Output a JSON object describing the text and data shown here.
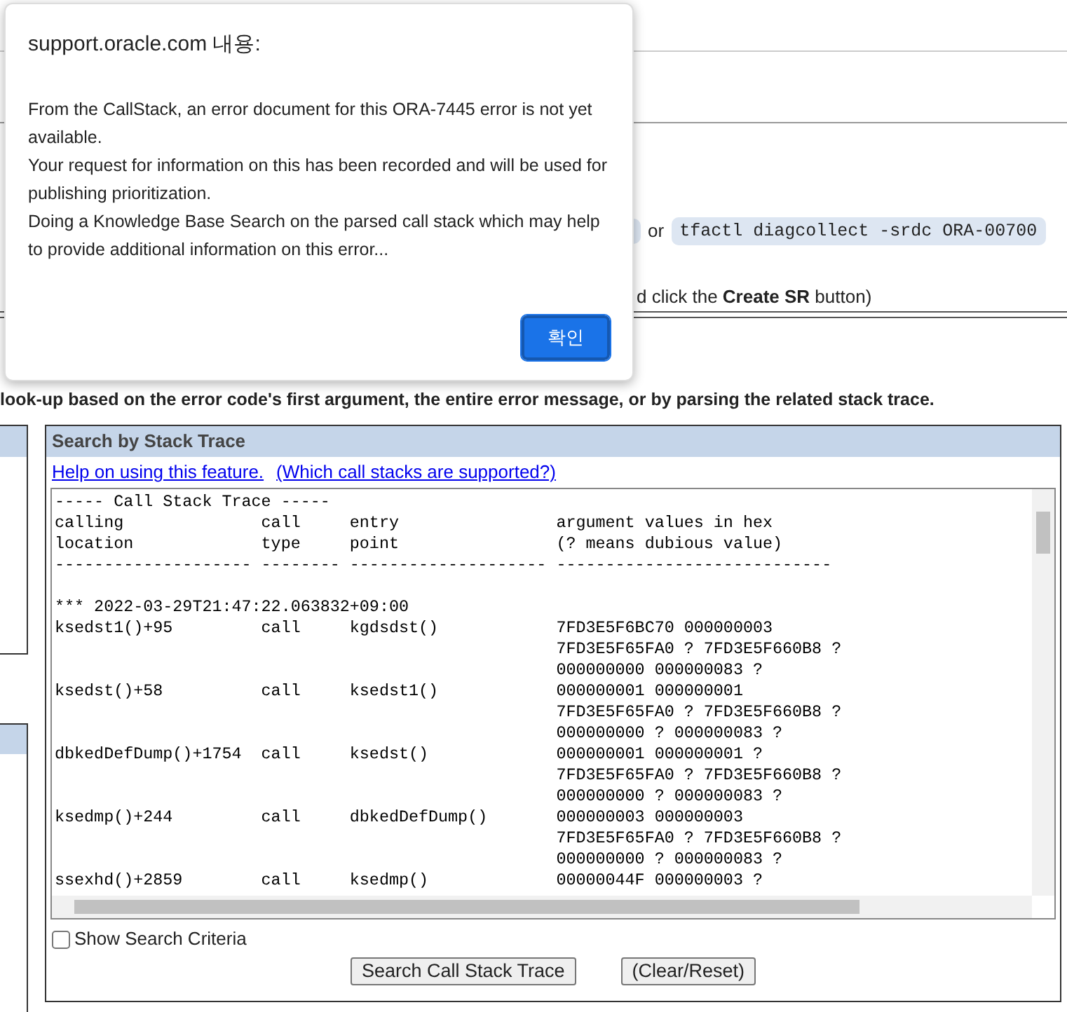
{
  "page": {
    "command_separator": "or",
    "command": "tfactl diagcollect -srdc ORA-00700",
    "instruction": "d click the **Create SR** button)",
    "intro": "look-up based on the error code's first argument, the entire error message, or by parsing the related stack trace."
  },
  "stack_trace_panel": {
    "title": "Search by Stack Trace",
    "links": [
      "Help on using this feature.",
      "(Which call stacks are supported?)"
    ],
    "trace_text": "----- Call Stack Trace -----\ncalling              call     entry                argument values in hex\nlocation             type     point                (? means dubious value)\n-------------------- -------- -------------------- ----------------------------\n\n*** 2022-03-29T21:47:22.063832+09:00\nksedst1()+95         call     kgdsdst()            7FD3E5F6BC70 000000003\n                                                   7FD3E5F65FA0 ? 7FD3E5F660B8 ?\n                                                   000000000 000000083 ?\nksedst()+58          call     ksedst1()            000000001 000000001\n                                                   7FD3E5F65FA0 ? 7FD3E5F660B8 ?\n                                                   000000000 ? 000000083 ?\ndbkedDefDump()+1754  call     ksedst()             000000001 000000001 ?\n                                                   7FD3E5F65FA0 ? 7FD3E5F660B8 ?\n                                                   000000000 ? 000000083 ?\nksedmp()+244         call     dbkedDefDump()       000000003 000000003\n                                                   7FD3E5F65FA0 ? 7FD3E5F660B8 ?\n                                                   000000000 ? 000000083 ?\nssexhd()+2859        call     ksedmp()             00000044F 000000003 ?",
    "show_criteria": {
      "label": "Show Search Criteria",
      "checked": false
    },
    "buttons": [
      "Search Call Stack Trace",
      "(Clear/Reset)"
    ]
  },
  "dialog": {
    "title": "support.oracle.com 내용:",
    "message": [
      "From the CallStack, an error document for this ORA-7445 error is not yet available.",
      "Your request for information on this has been recorded and will be used for publishing prioritization.",
      "Doing a Knowledge Base Search on the parsed call stack which may help to provide additional information on this error..."
    ],
    "ok": "확인"
  }
}
